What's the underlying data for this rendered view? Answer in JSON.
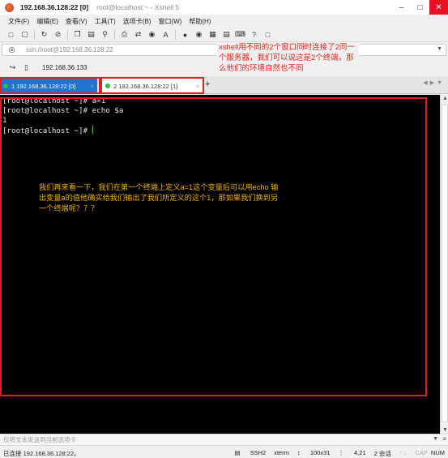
{
  "titlebar": {
    "title": "192.168.36.128:22 [0]",
    "subtitle": "root@localhost:~ - Xshell 5"
  },
  "menu": [
    "文件(F)",
    "编辑(E)",
    "查看(V)",
    "工具(T)",
    "选项卡(B)",
    "窗口(W)",
    "帮助(H)"
  ],
  "address": {
    "text": "ssh://root@192.168.36.128:22"
  },
  "session": {
    "text": "192.168.36.133"
  },
  "tabs": [
    {
      "label": "1 192.168.36.128:22 [0]",
      "active": true
    },
    {
      "label": "2 192.168.36.128:22 [1]",
      "active": false
    }
  ],
  "terminal": {
    "lines": [
      "[root@localhost ~]# a=1",
      "[root@localhost ~]# echo $a",
      "1",
      "[root@localhost ~]# "
    ],
    "note": "我们再来看一下，我们在第一个终端上定义a=1这个变量后可以用echo 输出变量a的值他确实给我们输出了我们所定义的这个1，那如果我们换到另一个终端呢？？？"
  },
  "annotation": {
    "text": "xshell用不同的2个窗口同时连接了2同一个服务器，我们可以说这是2个终端，那么他们的环境自然也不同"
  },
  "compose": {
    "placeholder": "仅将文本发送到当前选项卡"
  },
  "status": {
    "left": "已连接 192.168.36.128:22。",
    "protocol": "SSH2",
    "term": "xterm",
    "size": "100x31",
    "cursor": "4,21",
    "sessions": "2 会话",
    "caps": "CAP",
    "num": "NUM"
  },
  "colors": {
    "tab_active": "#1e74cf",
    "highlight": "#e02020",
    "terminal_bg": "#000000",
    "note_text": "#f0b000",
    "annotation_text": "#e0231e"
  }
}
